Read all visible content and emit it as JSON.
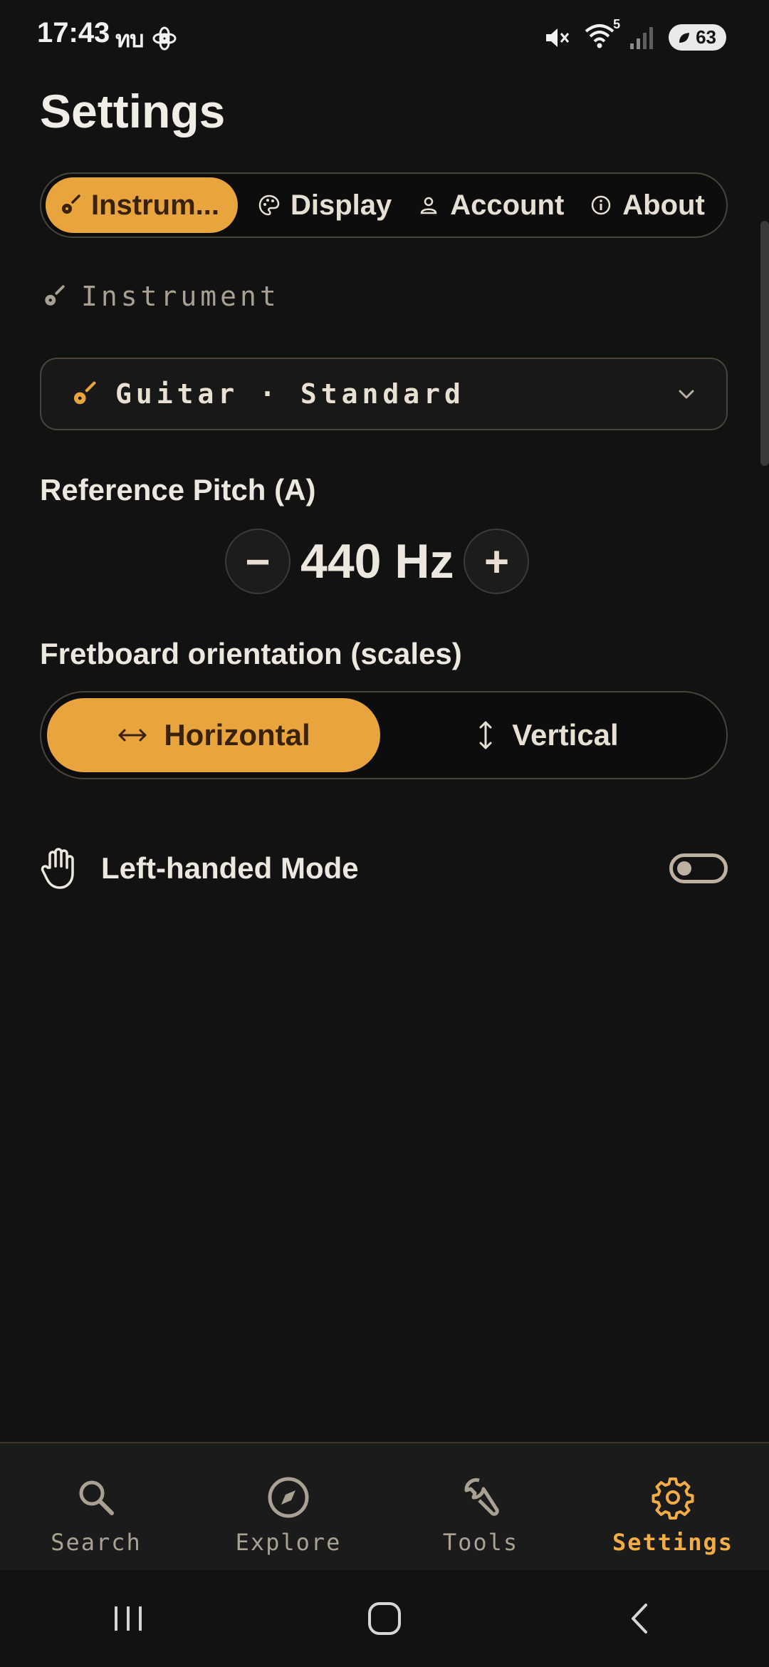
{
  "status": {
    "time": "17:43",
    "network": "ทบ",
    "wifi_sub": "5",
    "battery": "63"
  },
  "page": {
    "title": "Settings"
  },
  "tabs": [
    {
      "label": "Instrum...",
      "icon": "guitar-icon",
      "active": true
    },
    {
      "label": "Display",
      "icon": "palette-icon",
      "active": false
    },
    {
      "label": "Account",
      "icon": "person-icon",
      "active": false
    },
    {
      "label": "About",
      "icon": "info-icon",
      "active": false
    }
  ],
  "instrument_section": {
    "label": "Instrument",
    "select_value": "Guitar · Standard"
  },
  "reference_pitch": {
    "label": "Reference Pitch (A)",
    "value": "440 Hz",
    "minus": "−",
    "plus": "+"
  },
  "fretboard": {
    "label": "Fretboard orientation (scales)",
    "options": [
      {
        "label": "Horizontal",
        "icon": "horizontal-arrows-icon",
        "active": true
      },
      {
        "label": "Vertical",
        "icon": "vertical-arrows-icon",
        "active": false
      }
    ]
  },
  "left_handed": {
    "label": "Left-handed Mode",
    "enabled": false
  },
  "bottom_nav": [
    {
      "label": "Search",
      "icon": "search-icon",
      "active": false
    },
    {
      "label": "Explore",
      "icon": "compass-icon",
      "active": false
    },
    {
      "label": "Tools",
      "icon": "wrench-icon",
      "active": false
    },
    {
      "label": "Settings",
      "icon": "gear-icon",
      "active": true
    }
  ],
  "colors": {
    "accent": "#e8a53d",
    "background": "#121212",
    "nav_background": "#1b1b1b",
    "muted_text": "#a9a193"
  }
}
